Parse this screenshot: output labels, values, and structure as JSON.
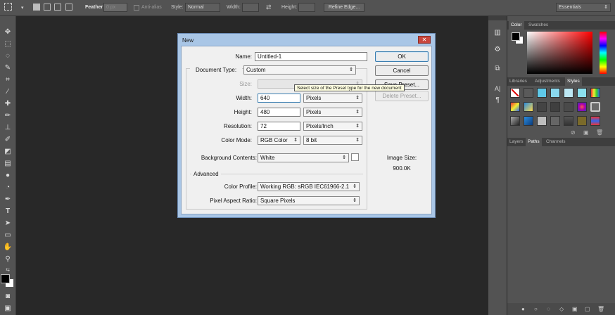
{
  "options_bar": {
    "feather_label": "Feather:",
    "feather_value": "0 px",
    "antialias_label": "Anti-alias",
    "style_label": "Style:",
    "style_value": "Normal",
    "width_label": "Width:",
    "height_label": "Height:",
    "refine_edge": "Refine Edge...",
    "workspace": "Essentials"
  },
  "panels": {
    "color_tabs": [
      "Color",
      "Swatches"
    ],
    "styles_tabs": [
      "Libraries",
      "Adjustments",
      "Styles"
    ],
    "layers_tabs": [
      "Layers",
      "Paths",
      "Channels"
    ]
  },
  "dialog": {
    "title": "New",
    "close": "✕",
    "name_label": "Name:",
    "name_value": "Untitled-1",
    "doc_type_label": "Document Type:",
    "doc_type_value": "Custom",
    "size_label": "Size:",
    "size_value": "",
    "width_label": "Width:",
    "width_value": "640",
    "width_unit": "Pixels",
    "height_label": "Height:",
    "height_value": "480",
    "height_unit": "Pixels",
    "resolution_label": "Resolution:",
    "resolution_value": "72",
    "resolution_unit": "Pixels/Inch",
    "color_mode_label": "Color Mode:",
    "color_mode_value": "RGB Color",
    "bit_depth_value": "8 bit",
    "bg_label": "Background Contents:",
    "bg_value": "White",
    "advanced_label": "Advanced",
    "color_profile_label": "Color Profile:",
    "color_profile_value": "Working RGB:  sRGB IEC61966-2.1",
    "pixel_aspect_label": "Pixel Aspect Ratio:",
    "pixel_aspect_value": "Square Pixels",
    "ok": "OK",
    "cancel": "Cancel",
    "save_preset": "Save Preset...",
    "delete_preset": "Delete Preset...",
    "image_size_label": "Image Size:",
    "image_size_value": "900.0K",
    "tooltip": "Select size of the Preset type for the new document"
  }
}
